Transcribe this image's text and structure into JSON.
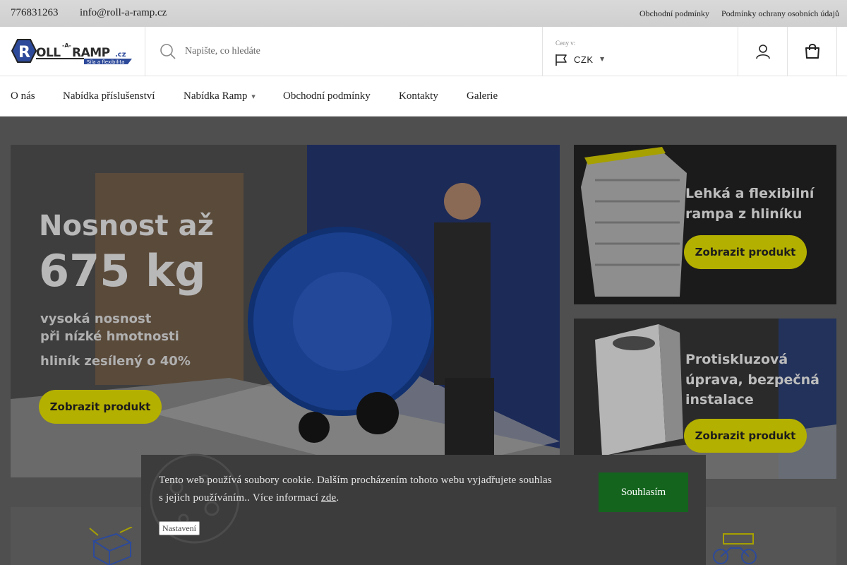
{
  "topbar": {
    "phone": "776831263",
    "email": "info@roll-a-ramp.cz",
    "links": [
      "Obchodní podmínky",
      "Podmínky ochrany osobních údajů"
    ]
  },
  "header": {
    "logo_text": "ROLL-A-RAMP.cz",
    "logo_tagline": "Síla a flexibilita",
    "search_placeholder": "Napište, co hledáte",
    "currency_caption": "Ceny v:",
    "currency_value": "CZK",
    "icons": [
      "search-icon",
      "flag-icon",
      "user-icon",
      "shopping-bag-icon"
    ]
  },
  "nav": {
    "items": [
      {
        "label": "O nás",
        "has_dropdown": false
      },
      {
        "label": "Nabídka příslušenství",
        "has_dropdown": false
      },
      {
        "label": "Nabídka Ramp",
        "has_dropdown": true
      },
      {
        "label": "Obchodní podmínky",
        "has_dropdown": false
      },
      {
        "label": "Kontakty",
        "has_dropdown": false
      },
      {
        "label": "Galerie",
        "has_dropdown": false
      }
    ]
  },
  "banners": {
    "main": {
      "title_line1": "Nosnost až",
      "title_line2": "675 kg",
      "sub_line1": "vysoká nosnost",
      "sub_line2": "při nízké hmotnosti",
      "sub_line3": "hliník zesílený o 40%",
      "button": "Zobrazit produkt"
    },
    "side1": {
      "line1": "Lehká a flexibilní",
      "line2": "rampa z hliníku",
      "button": "Zobrazit produkt"
    },
    "side2": {
      "line1": "Protiskluzová",
      "line2": "úprava, bezpečná",
      "line3": "instalace",
      "button": "Zobrazit produkt"
    }
  },
  "cookie": {
    "text": "Tento web používá soubory cookie. Dalším procházením tohoto webu vyjadřujete souhlas s jejich používáním.. Více informací ",
    "link": "zde",
    "text_end": ".",
    "accept": "Souhlasím",
    "settings": "Nastavení"
  },
  "colors": {
    "topbar_bg": "#d4d4d4",
    "accent_yellow": "#b4b000",
    "accept_green": "#14641e",
    "logo_blue": "#2d4a9a"
  }
}
